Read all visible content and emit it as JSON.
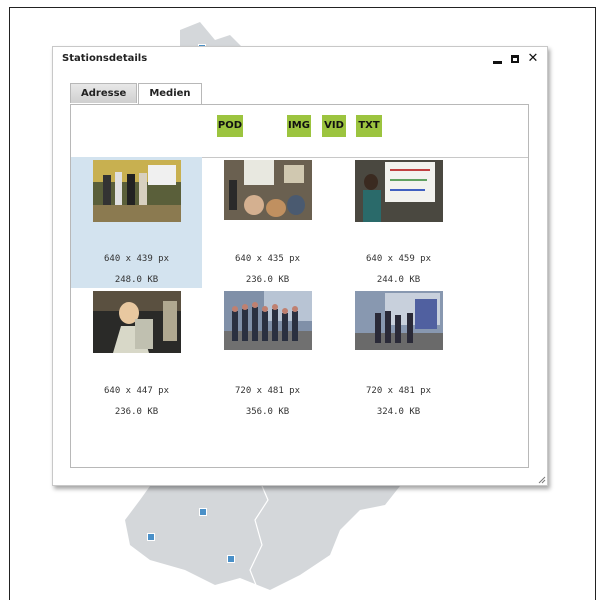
{
  "window": {
    "title": "Stationsdetails",
    "controls": [
      {
        "name": "minimize-button",
        "glyph": ""
      },
      {
        "name": "maximize-button",
        "glyph": ""
      },
      {
        "name": "close-button",
        "glyph": "✕"
      }
    ]
  },
  "tabs": [
    {
      "label": "Adresse",
      "active": false
    },
    {
      "label": "Medien",
      "active": true
    }
  ],
  "media_filters": [
    "POD",
    "IMG",
    "VID",
    "TXT"
  ],
  "media_items": [
    {
      "dimensions": "640 x 439 px",
      "size": "248.0 KB",
      "selected": true
    },
    {
      "dimensions": "640 x 435 px",
      "size": "236.0 KB",
      "selected": false
    },
    {
      "dimensions": "640 x 459 px",
      "size": "244.0 KB",
      "selected": false
    },
    {
      "dimensions": "640 x 447 px",
      "size": "236.0 KB",
      "selected": false
    },
    {
      "dimensions": "720 x 481 px",
      "size": "356.0 KB",
      "selected": false
    },
    {
      "dimensions": "720 x 481 px",
      "size": "324.0 KB",
      "selected": false
    }
  ],
  "colors": {
    "accent_button": "#9cc43f",
    "selection": "#d3e3ef",
    "map_fill": "#cfd3d6",
    "marker": "#4a90c8"
  }
}
